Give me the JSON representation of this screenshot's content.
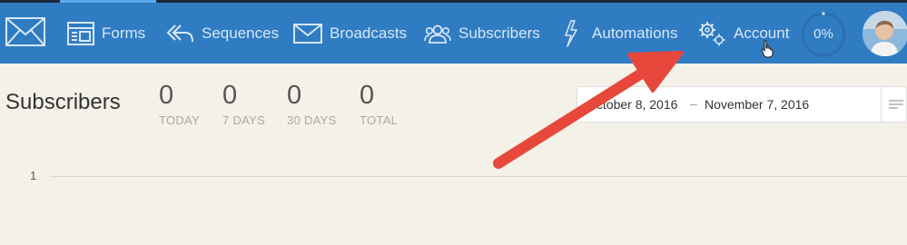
{
  "nav": {
    "items": [
      {
        "label": "Forms",
        "icon": "form-icon"
      },
      {
        "label": "Sequences",
        "icon": "sequences-icon"
      },
      {
        "label": "Broadcasts",
        "icon": "envelope-icon"
      },
      {
        "label": "Subscribers",
        "icon": "users-icon"
      },
      {
        "label": "Automations",
        "icon": "lightning-icon"
      },
      {
        "label": "Account",
        "icon": "gears-icon"
      }
    ],
    "progress": "0%",
    "progress_fraction": 0,
    "colors": {
      "bar": "#2f7cc3",
      "text": "#d7e7f6",
      "active": "#5aa9ee"
    }
  },
  "page": {
    "title": "Subscribers",
    "stats": [
      {
        "value": "0",
        "label": "TODAY"
      },
      {
        "value": "0",
        "label": "7 DAYS"
      },
      {
        "value": "0",
        "label": "30 DAYS"
      },
      {
        "value": "0",
        "label": "TOTAL"
      }
    ],
    "date_start": "October 8, 2016",
    "date_sep": "–",
    "date_end": "November 7, 2016",
    "y_tick": "1"
  },
  "annotation": {
    "color": "#e8473c"
  }
}
